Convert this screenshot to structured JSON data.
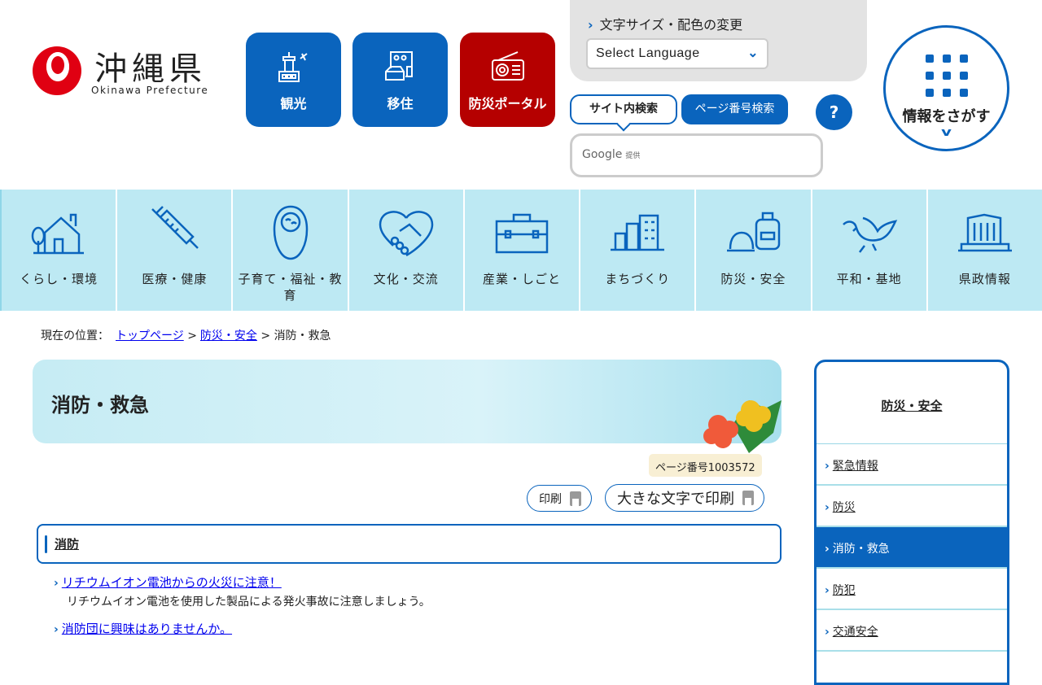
{
  "header": {
    "logo_title": "沖縄県",
    "logo_sub": "Okinawa Prefecture",
    "quick": [
      {
        "label": "観光",
        "icon": "tower-plane-icon"
      },
      {
        "label": "移住",
        "icon": "house-building-icon"
      },
      {
        "label": "防災ポータル",
        "icon": "radio-icon"
      }
    ],
    "font_color_label": "文字サイズ・配色の変更",
    "language_select": "Select Language",
    "search_tabs": [
      "サイト内検索",
      "ページ番号検索"
    ],
    "help": "?",
    "search_brand": "Google",
    "search_brand_suffix": "提供",
    "find_info": "情報をさがす"
  },
  "colors": {
    "primary": "#0a64bd",
    "disaster": "#b50000",
    "nav_bg": "#bde9f3"
  },
  "nav": [
    {
      "label": "くらし・環境"
    },
    {
      "label": "医療・健康"
    },
    {
      "label": "子育て・福祉・教育"
    },
    {
      "label": "文化・交流"
    },
    {
      "label": "産業・しごと"
    },
    {
      "label": "まちづくり"
    },
    {
      "label": "防災・安全"
    },
    {
      "label": "平和・基地"
    },
    {
      "label": "県政情報"
    }
  ],
  "breadcrumb": {
    "prefix": "現在の位置：",
    "items": [
      "トップページ",
      "防災・安全"
    ],
    "current": "消防・救急",
    "sep": ">"
  },
  "main": {
    "title": "消防・救急",
    "page_number": "ページ番号1003572",
    "print": "印刷",
    "print_large": "大きな文字で印刷",
    "section": "消防",
    "links": [
      {
        "title": "リチウムイオン電池からの火災に注意！",
        "desc": "リチウムイオン電池を使用した製品による発火事故に注意しましょう。"
      },
      {
        "title": "消防団に興味はありませんか。"
      }
    ]
  },
  "sidebar": {
    "heading": "防災・安全",
    "items": [
      {
        "label": "緊急情報"
      },
      {
        "label": "防災"
      },
      {
        "label": "消防・救急",
        "active": true
      },
      {
        "label": "防犯"
      },
      {
        "label": "交通安全"
      }
    ]
  }
}
